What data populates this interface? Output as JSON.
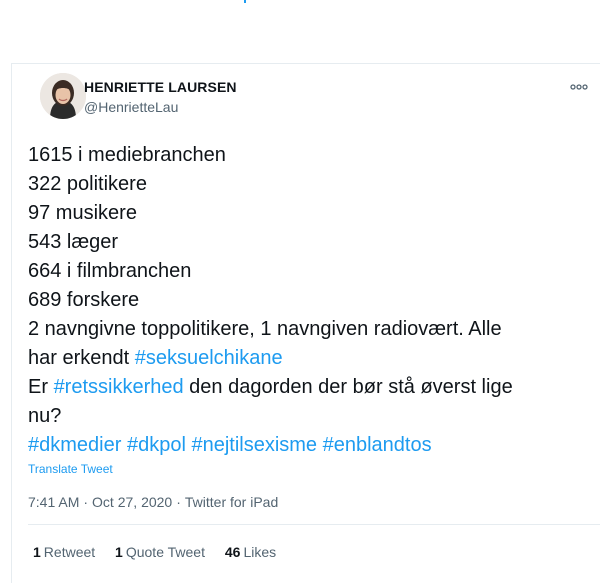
{
  "author": {
    "name": "HENRIETTE LAURSEN",
    "handle": "@HenrietteLau"
  },
  "tweet": {
    "line1": "1615 i mediebranchen",
    "line2": "322 politikere",
    "line3": "97 musikere",
    "line4": "543 læger",
    "line5": "664 i filmbranchen",
    "line6": "689 forskere",
    "line7": "2 navngivne toppolitikere, 1 navngiven radiovært. Alle",
    "line8_text": "har erkendt ",
    "line8_tag": "#seksuelchikane",
    "line9_tag": "#retssikkerhed",
    "line9_pre": "Er ",
    "line9_text": " den dagorden der bør stå øverst lige",
    "line10": "nu?",
    "tags": [
      "#dkmedier",
      "#dkpol",
      "#nejtilsexisme",
      "#enblandtos"
    ]
  },
  "translate_label": "Translate Tweet",
  "meta": {
    "time": "7:41 AM",
    "date": "Oct 27, 2020",
    "source": "Twitter for iPad",
    "separator": "·"
  },
  "stats": {
    "retweets_count": "1",
    "retweets_label": "Retweet",
    "quotes_count": "1",
    "quotes_label": "Quote Tweet",
    "likes_count": "46",
    "likes_label": "Likes"
  },
  "colors": {
    "link": "#1d9bf0",
    "text": "#0f1419",
    "muted": "#536471"
  },
  "icons": {
    "more": "more-dots-icon"
  }
}
